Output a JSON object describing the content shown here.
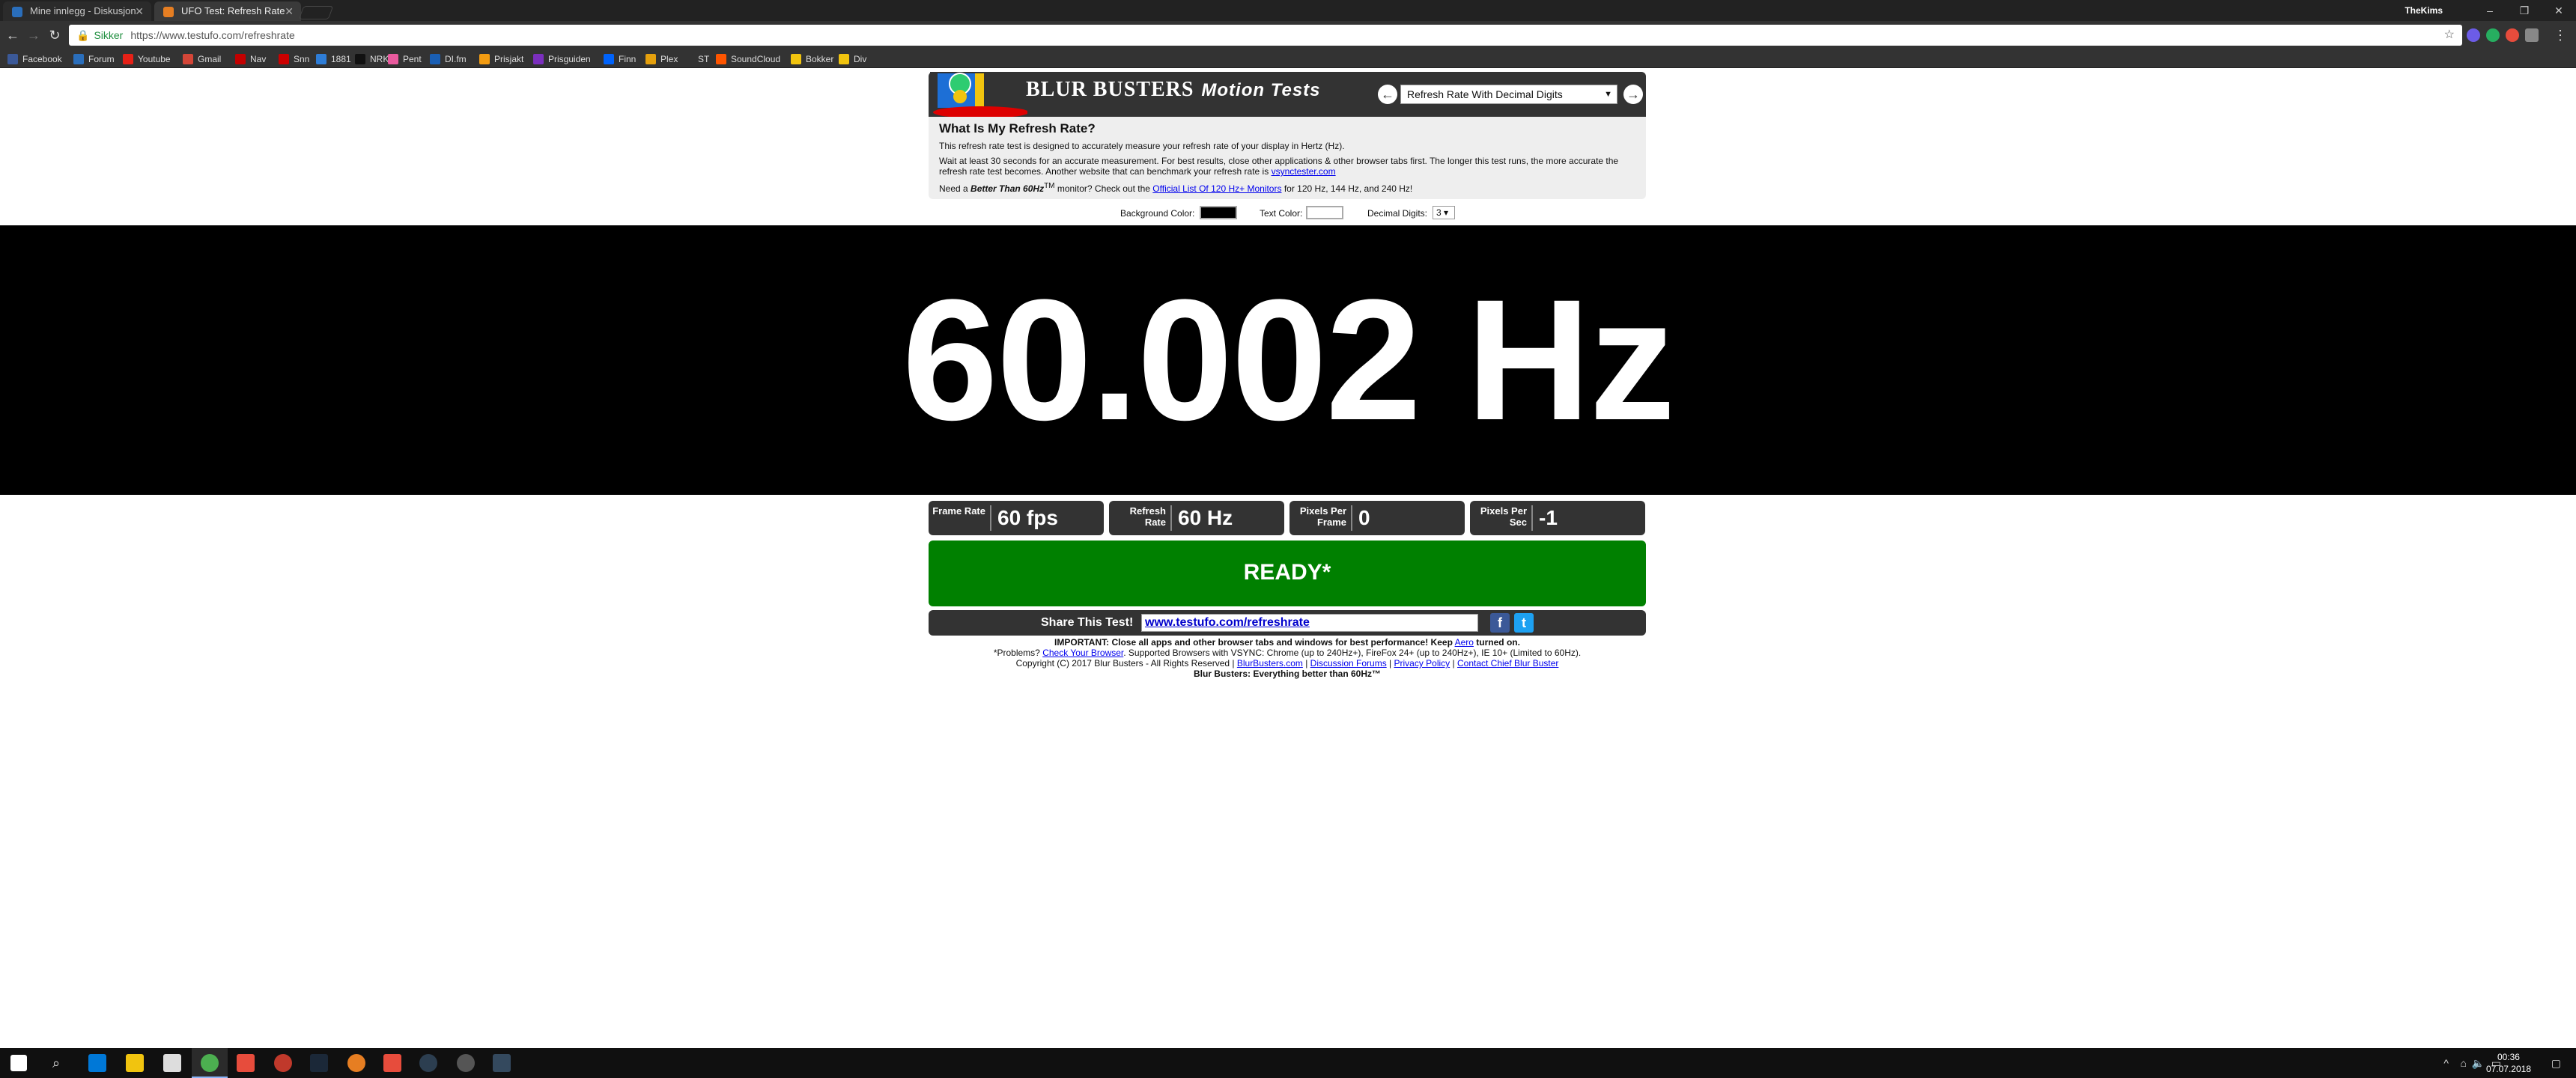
{
  "browser": {
    "tabs": [
      {
        "title": "Mine innlegg - Diskusjon",
        "active": false
      },
      {
        "title": "UFO Test: Refresh Rate",
        "active": true
      }
    ],
    "profile_name": "TheKims",
    "window_controls": {
      "minimize": "–",
      "restore": "❐",
      "close": "✕"
    },
    "address": {
      "secure_label": "Sikker",
      "url": "https://www.testufo.com/refreshrate"
    },
    "bookmarks": [
      {
        "label": "Facebook",
        "color": "#3b5998"
      },
      {
        "label": "Forum",
        "color": "#2a6ebb"
      },
      {
        "label": "Youtube",
        "color": "#e62117"
      },
      {
        "label": "Gmail",
        "color": "#d44638"
      },
      {
        "label": "Nav",
        "color": "#c30000"
      },
      {
        "label": "Snn",
        "color": "#cc0000"
      },
      {
        "label": "1881",
        "color": "#2e7dd7"
      },
      {
        "label": "NRK",
        "color": "#111111"
      },
      {
        "label": "Pent",
        "color": "#e95a9e"
      },
      {
        "label": "DI.fm",
        "color": "#1a5fb4"
      },
      {
        "label": "Prisjakt",
        "color": "#f39c12"
      },
      {
        "label": "Prisguiden",
        "color": "#7b2fbe"
      },
      {
        "label": "Finn",
        "color": "#0063fb"
      },
      {
        "label": "Plex",
        "color": "#e5a00d"
      },
      {
        "label": "ST",
        "color": "#333333"
      },
      {
        "label": "SoundCloud",
        "color": "#ff5500"
      },
      {
        "label": "Bokker",
        "color": "#f1c40f"
      },
      {
        "label": "Div",
        "color": "#f1c40f"
      }
    ]
  },
  "site": {
    "brand": "BLUR BUSTERS",
    "brand_suffix": "Motion Tests",
    "test_select": "Refresh Rate With Decimal Digits",
    "info": {
      "heading": "What Is My Refresh Rate?",
      "p1": "This refresh rate test is designed to accurately measure your refresh rate of your display in Hertz (Hz).",
      "p2": "Wait at least 30 seconds for an accurate measurement. For best results, close other applications & other browser tabs first. The longer this test runs, the more accurate the refresh rate test becomes. Another website that can benchmark your refresh rate is",
      "p2_link": "vsynctester.com",
      "p3_a": "Need a",
      "p3_b": "Better Than 60Hz",
      "p3_c": "monitor? Check out the",
      "p3_link": "Official List Of 120 Hz+ Monitors",
      "p3_d": "for 120 Hz, 144 Hz, and 240 Hz!"
    },
    "options": {
      "bg_label": "Background Color:",
      "bg_color": "#000000",
      "text_label": "Text Color:",
      "text_color": "#ffffff",
      "digits_label": "Decimal Digits:",
      "digits_value": "3"
    },
    "measurement": "60.002 Hz",
    "stats": [
      {
        "label": "Frame Rate",
        "value": "60 fps"
      },
      {
        "label": "Refresh Rate",
        "value": "60 Hz"
      },
      {
        "label": "Pixels Per Frame",
        "value": "0"
      },
      {
        "label": "Pixels Per Sec",
        "value": "-1"
      }
    ],
    "status": "READY*",
    "share": {
      "label": "Share This Test!",
      "url": "www.testufo.com/refreshrate"
    },
    "footer": {
      "line1_a": "IMPORTANT: Close all apps and other browser tabs and windows for best performance! Keep",
      "line1_link": "Aero",
      "line1_b": "turned on.",
      "line2_a": "*Problems?",
      "line2_link": "Check Your Browser",
      "line2_b": ". Supported Browsers with VSYNC: Chrome (up to 240Hz+), FireFox 24+ (up to 240Hz+), IE 10+ (Limited to 60Hz).",
      "line3_a": "Copyright (C) 2017 Blur Busters - All Rights Reserved |",
      "links": [
        "BlurBusters.com",
        "Discussion Forums",
        "Privacy Policy",
        "Contact Chief Blur Buster"
      ],
      "line4": "Blur Busters: Everything better than 60Hz™"
    },
    "colors": {
      "header": "#333333",
      "ready": "#008000",
      "link": "#0000ee"
    }
  },
  "taskbar": {
    "time": "00:36",
    "date": "07.07.2018"
  }
}
